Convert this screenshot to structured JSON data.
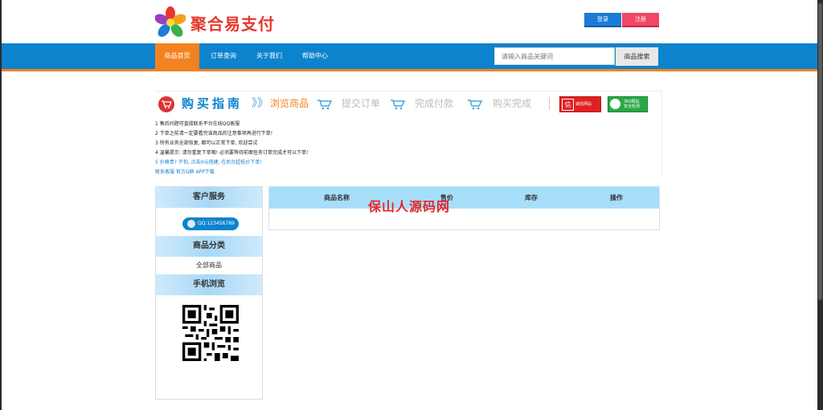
{
  "header": {
    "logo_text": "聚合易支付",
    "login_label": "登录",
    "register_label": "注册"
  },
  "nav": {
    "items": [
      {
        "label": "商品首页",
        "active": true
      },
      {
        "label": "订单查询",
        "active": false
      },
      {
        "label": "关于我们",
        "active": false
      },
      {
        "label": "帮助中心",
        "active": false
      }
    ],
    "search_placeholder": "请输入商品关键词",
    "search_button": "商品搜索"
  },
  "guide": {
    "title": "购买指南",
    "arrows": "》》",
    "steps": [
      {
        "label": "浏览商品",
        "active": true
      },
      {
        "label": "提交订单",
        "active": false
      },
      {
        "label": "完成付款",
        "active": false
      },
      {
        "label": "购买完成",
        "active": false
      }
    ],
    "badge_chengxin": "诚信网站",
    "badge_360": "360网站\n安全检测",
    "notices": [
      "1 售后问题可直接联系平台在线QQ客服",
      "2 下单之前请一定要看完该商品的注意事项再进行下单!",
      "3 所有业务全部恢复, 都可以正常下单, 欢迎尝试",
      "4 温馨提示: 请勿重复下单哦! 必须要等待前面任务订单完成才可以下单!",
      "5 价格贵? 不怕, 点击0元搭建, 在后台超低价下单!"
    ],
    "links": "联系客服 官方Q群 APP下载"
  },
  "sidebar": {
    "service_title": "客户服务",
    "qq_label": "QQ:123456789",
    "category_title": "商品分类",
    "category_item": "全部商品",
    "mobile_title": "手机浏览"
  },
  "table": {
    "headers": [
      "商品名称",
      "售价",
      "库存",
      "操作"
    ]
  },
  "watermark": "保山人源码网",
  "colors": {
    "nav_blue": "#0e83cd",
    "accent_orange": "#f2821f",
    "register_red": "#f24662"
  }
}
